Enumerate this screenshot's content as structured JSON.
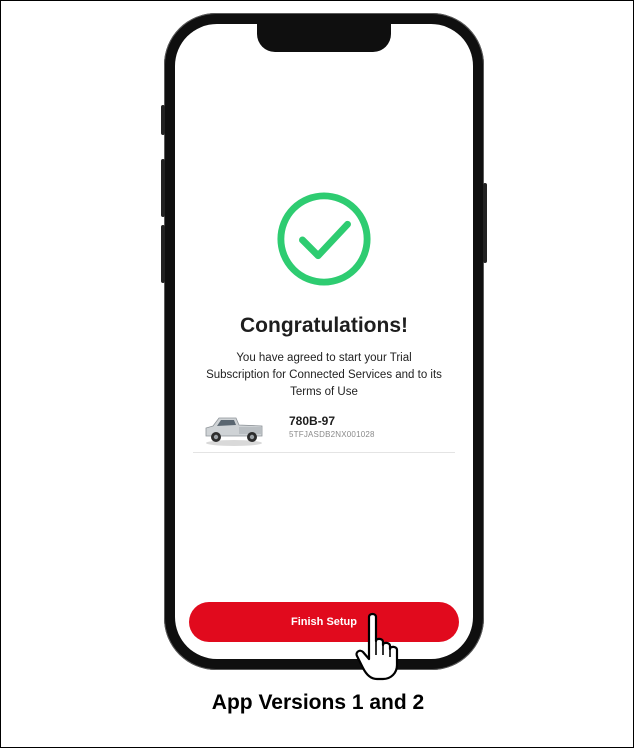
{
  "screen": {
    "title": "Congratulations!",
    "message": "You have agreed to start your Trial Subscription for Connected Services and to its Terms of Use",
    "vehicle": {
      "name": "780B-97",
      "vin": "5TFJASDB2NX001028"
    },
    "finish_button": "Finish Setup"
  },
  "caption": "App Versions 1 and 2",
  "colors": {
    "accent_red": "#e10a1d",
    "success_green": "#2ecc71"
  },
  "icons": [
    "check-circle-icon",
    "truck-image",
    "pointing-hand-icon"
  ]
}
